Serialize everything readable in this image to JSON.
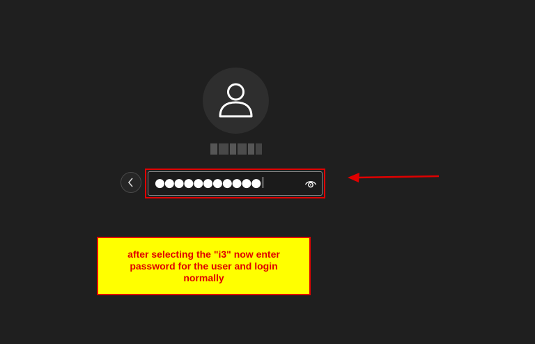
{
  "login": {
    "avatar_icon": "user-icon",
    "username": "",
    "back_icon": "chevron-left-icon",
    "password_masked": "●●●●●●●●●●●",
    "reveal_icon": "eye-icon"
  },
  "annotation": {
    "note": "after selecting the \"i3\" now enter password for the user and login normally",
    "arrow_icon": "arrow-left-icon",
    "colors": {
      "background": "#1f1f1f",
      "highlight_border": "#e00000",
      "note_background": "#ffff00",
      "note_text": "#e00000"
    }
  }
}
